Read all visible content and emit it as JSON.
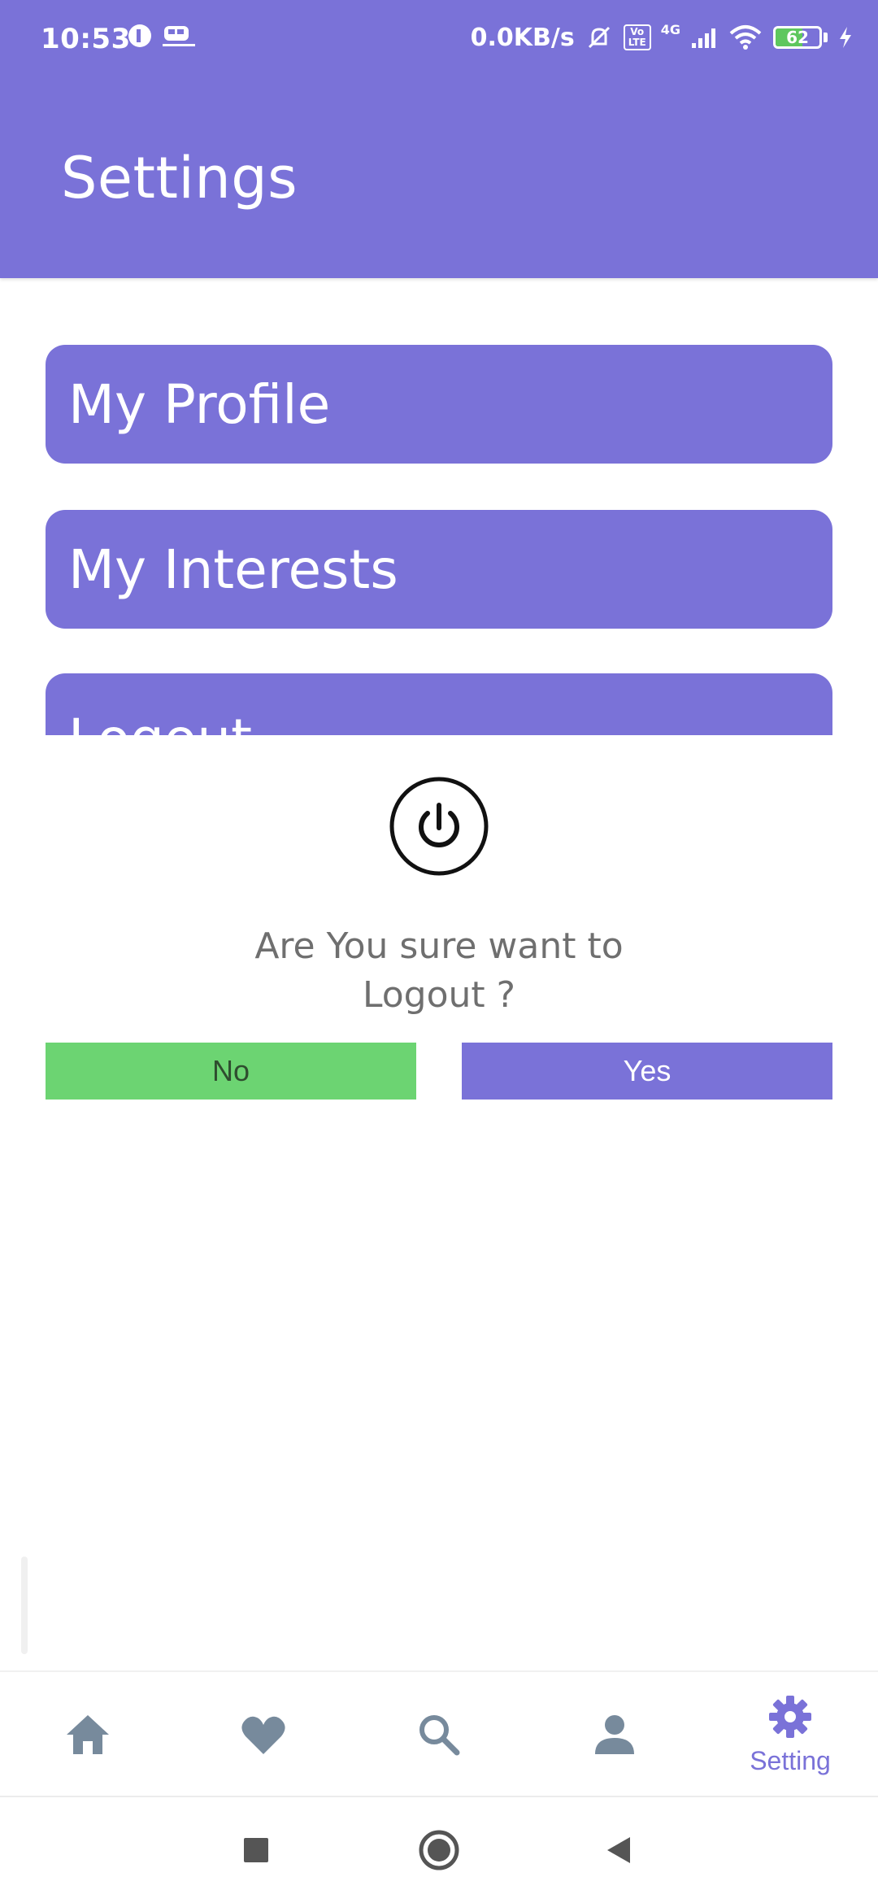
{
  "status_bar": {
    "time": "10:53",
    "network_speed": "0.0KB/s",
    "volte_label": "Vo LTE",
    "network_type": "4G",
    "battery_level": "62",
    "battery_fraction": 0.62
  },
  "app_bar": {
    "title": "Settings"
  },
  "menu": {
    "items": [
      {
        "label": "My Profile"
      },
      {
        "label": "My Interests"
      },
      {
        "label": "Logout"
      }
    ]
  },
  "dialog": {
    "message": "Are You sure want to Logout ?",
    "no_label": "No",
    "yes_label": "Yes"
  },
  "bottom_nav": {
    "active_label": "Setting"
  },
  "colors": {
    "primary": "#7a72d8",
    "confirm_no": "#6cd472",
    "inactive_icon": "#778a9c"
  }
}
